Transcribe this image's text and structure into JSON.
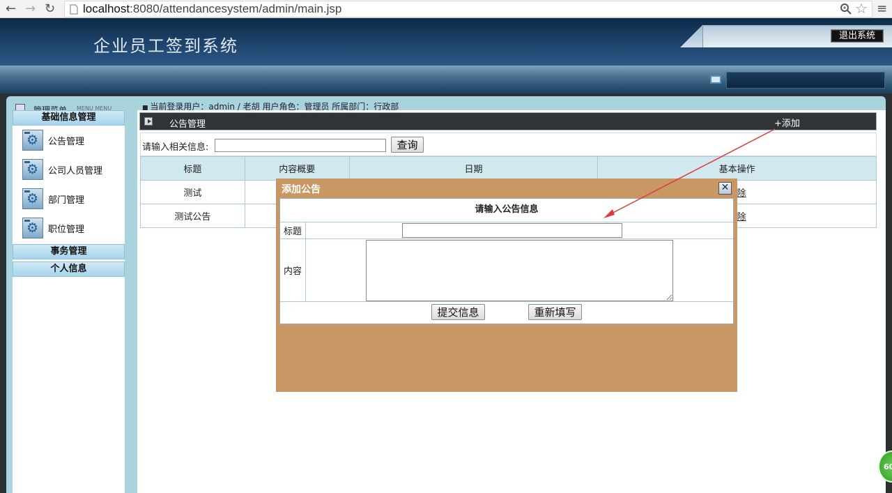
{
  "browser": {
    "url_host": "localhost",
    "url_path": ":8080/attendancesystem/admin/main.jsp"
  },
  "header": {
    "title": "企业员工签到系统",
    "logout_label": "退出系统"
  },
  "menu_strip": {
    "label": "管理菜单",
    "sub": "MENU MENU"
  },
  "login_info": "当前登录用户：admin / 老胡    用户角色：管理员    所属部门：行政部",
  "sidebar": {
    "group_basic": "基础信息管理",
    "items": [
      {
        "label": "公告管理"
      },
      {
        "label": "公司人员管理"
      },
      {
        "label": "部门管理"
      },
      {
        "label": "职位管理"
      }
    ],
    "group_affairs": "事务管理",
    "group_personal": "个人信息"
  },
  "main": {
    "title": "公告管理",
    "add_label": "+添加",
    "search_label": "请输入相关信息:",
    "search_value": "",
    "search_button": "查询",
    "columns": [
      "标题",
      "内容概要",
      "日期",
      "基本操作"
    ],
    "rows": [
      {
        "title": "测试",
        "summary": "",
        "date": "",
        "action": "删除"
      },
      {
        "title": "测试公告",
        "summary": "",
        "date": "",
        "action": "删除"
      }
    ]
  },
  "modal": {
    "title": "添加公告",
    "close_symbol": "✕",
    "heading": "请输入公告信息",
    "title_label": "标题",
    "title_value": "",
    "content_label": "内容",
    "content_value": "",
    "submit_label": "提交信息",
    "reset_label": "重新填写"
  },
  "badge": {
    "text": "60"
  },
  "colors": {
    "modal_bg": "#c99764",
    "annotation_arrow": "#e03a3a"
  }
}
